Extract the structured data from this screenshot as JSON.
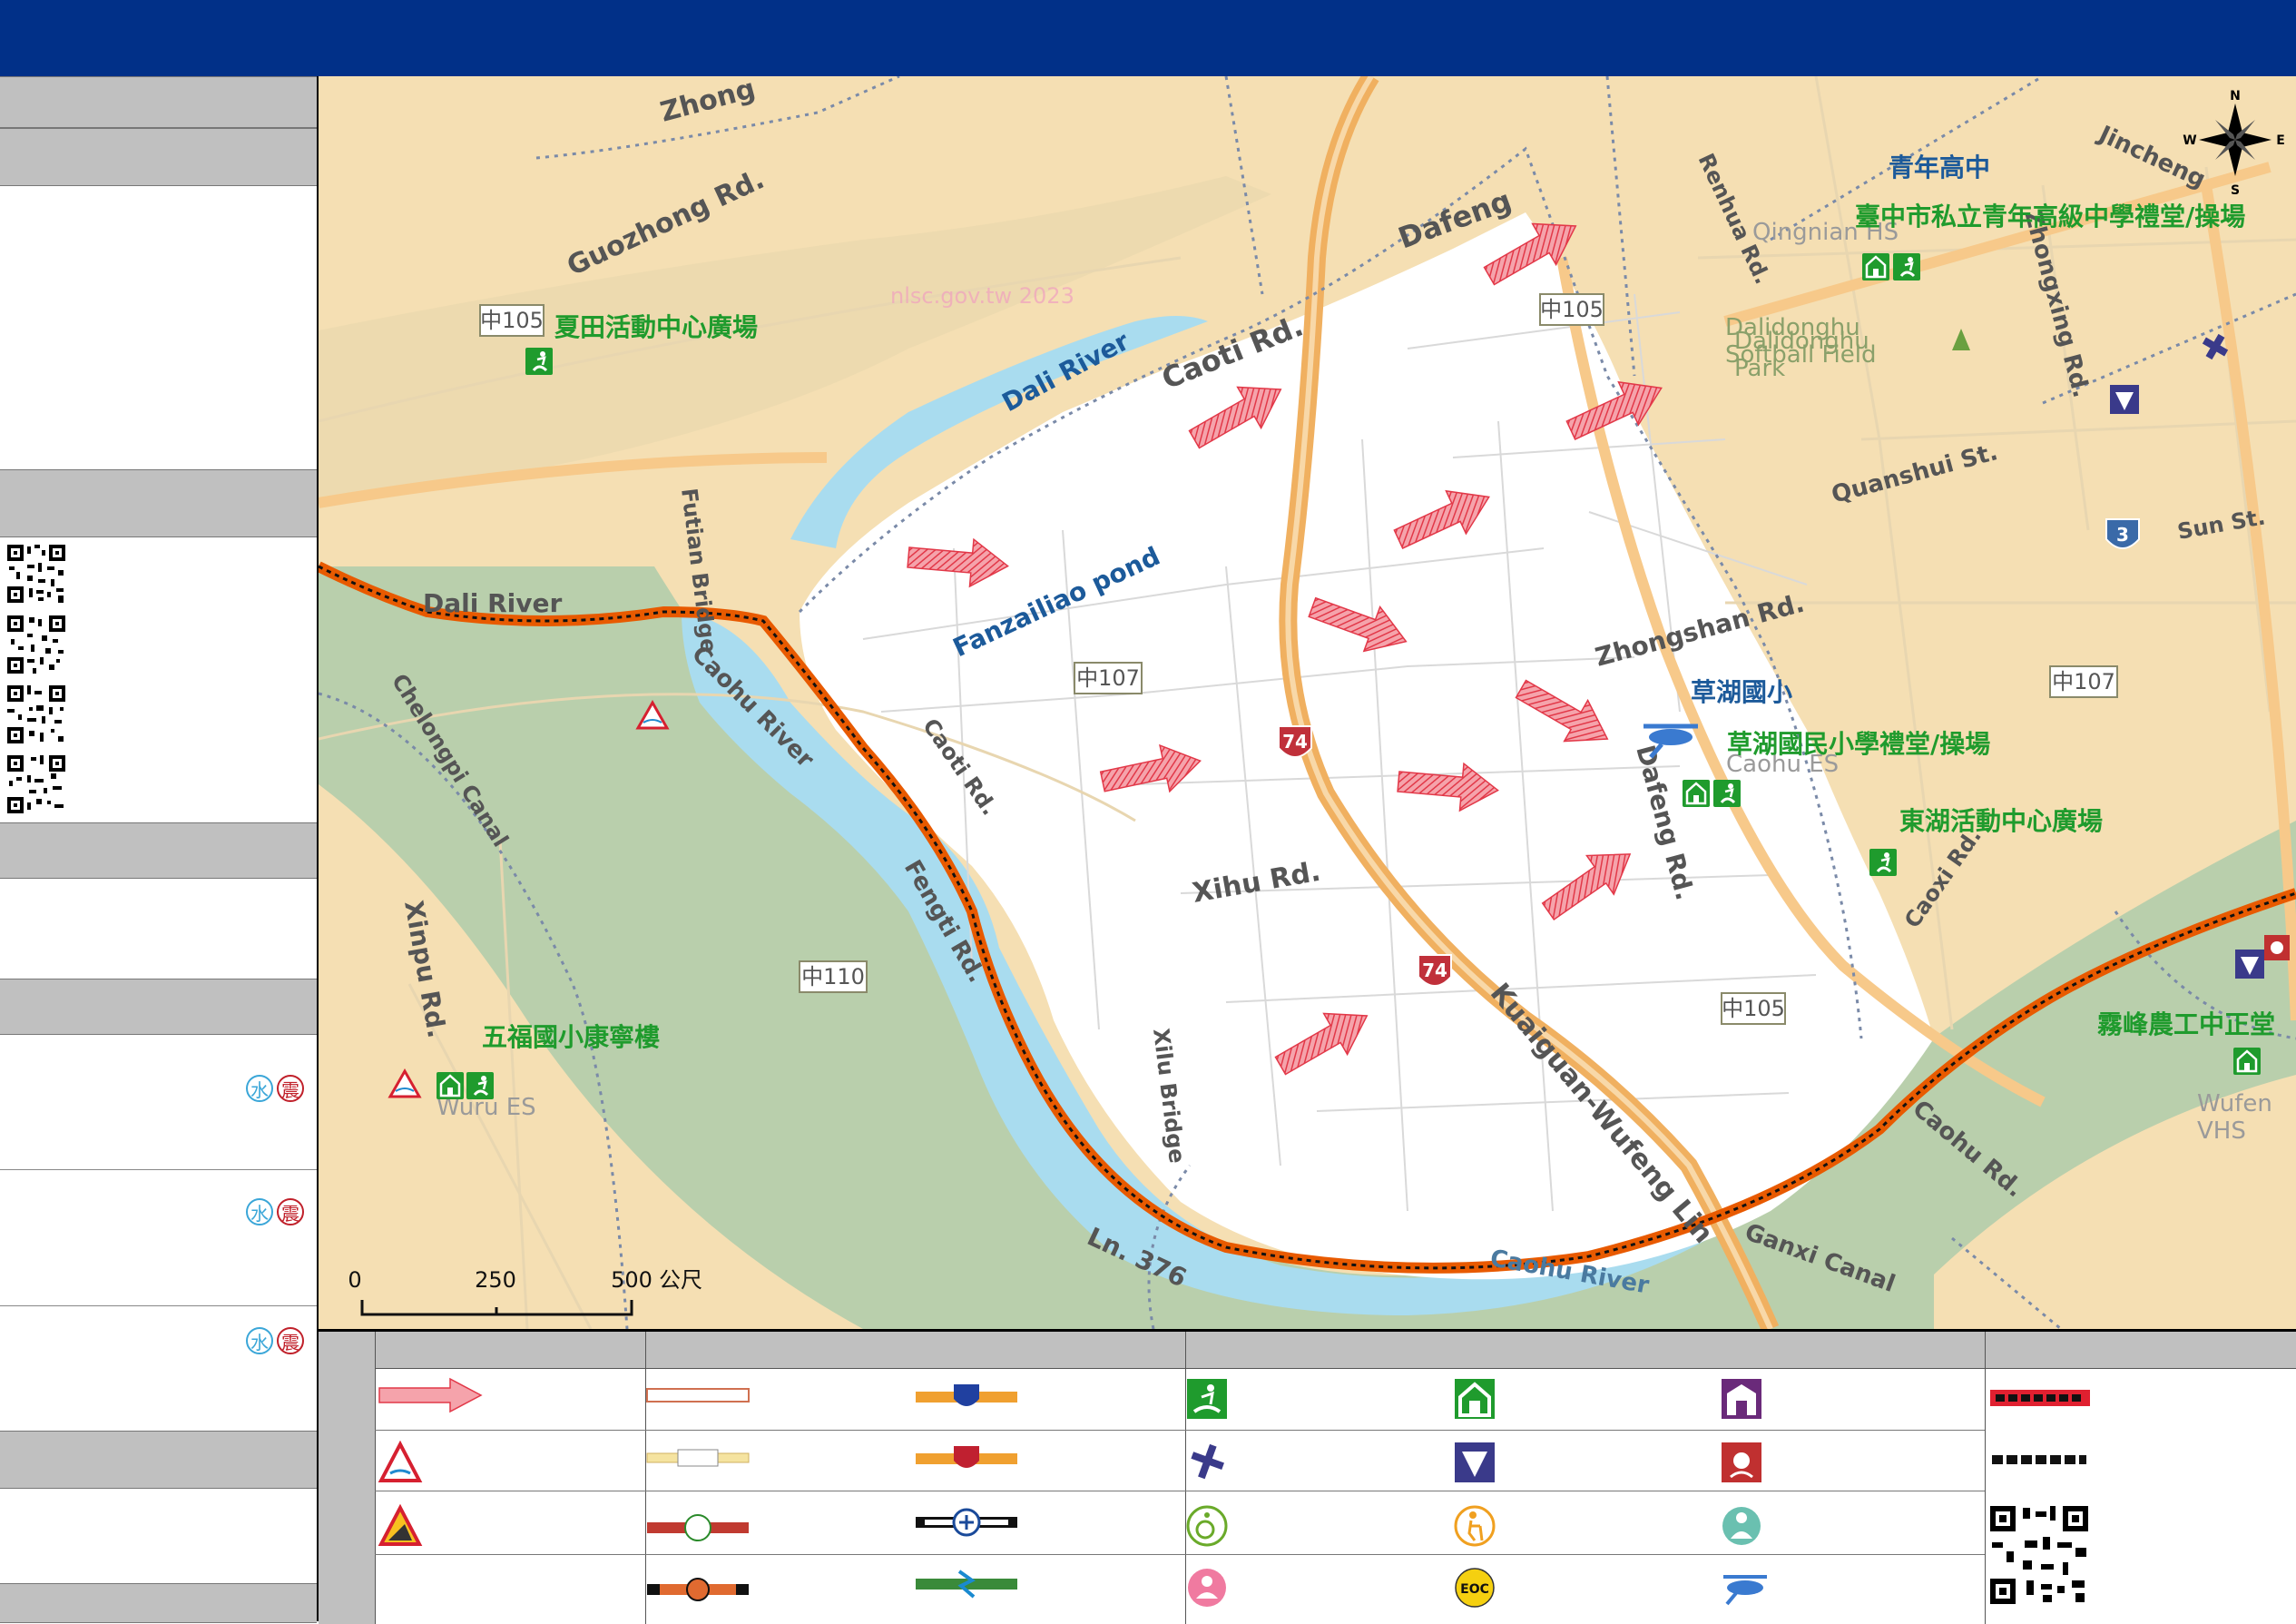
{
  "header": {
    "title": ""
  },
  "map": {
    "labels": {
      "zhong": "Zhong",
      "guozhong_rd": "Guozhong Rd.",
      "dafeng_top": "Dafeng",
      "caoti_rd_top": "Caoti Rd.",
      "dali_river_top": "Dali River",
      "dali_river_left": "Dali River",
      "fanzailiao_pond": "Fanzailiao pond",
      "caohu_river_left": "Caohu River",
      "caoti_rd_mid": "Caoti Rd.",
      "futian_bridge": "Futian Bridge",
      "guangxing_canal": "Chelongpi Canal",
      "xinpu_rd": "Xinpu Rd.",
      "fengti_rd": "Fengti Rd.",
      "xilu_bridge": "Xilu Bridge",
      "ln376": "Ln. 376",
      "xihu_rd": "Xihu Rd.",
      "zhongshan_rd": "Zhongshan Rd.",
      "dafeng_rd": "Dafeng Rd.",
      "kuaiguan_wufeng": "Kuaiguan-Wufeng Lin",
      "caohu_river_bottom": "Caohu River",
      "ganxi_canal": "Ganxi Canal",
      "caohu_rd": "Caohu Rd.",
      "caoxi_rd": "Caoxi Rd.",
      "renhua_rd": "Renhua Rd.",
      "jincheng": "Jincheng",
      "quanshui_st": "Quanshui St.",
      "zhongxing_rd": "Zhongxing Rd.",
      "qingnian_hs": "Qingnian HS",
      "dalidonghu_softball": "Dalidonghu\nSoftball Field",
      "dalidonghu_park": "Dalidonghu\nPark",
      "caohu_es": "Caohu ES",
      "wuru_es": "Wuru ES",
      "wufeng_vhs": "Wufen\nVHS",
      "sun_st": "Sun St.",
      "watermark": "nlsc.gov.tw 2023"
    },
    "roads": {
      "z105_a": "中105",
      "z105_b": "中105",
      "z105_c": "中105",
      "z107_a": "中107",
      "z107_b": "中107",
      "z110": "中110",
      "r74_a": "74",
      "r74_b": "74",
      "r3": "3"
    },
    "places": {
      "qingnian_name": "青年高中",
      "qingnian_shelter": "臺中市私立青年高級中學禮堂/操場",
      "xiatian": "夏田活動中心廣場",
      "caohu_school": "草湖國小",
      "caohu_shelter": "草湖國民小學禮堂/操場",
      "donghu": "東湖活動中心廣場",
      "wufu": "五福國小康寧樓",
      "wufeng_ag": "霧峰農工中正堂"
    },
    "scale": {
      "t0": "0",
      "t1": "250",
      "t2": "500",
      "unit": "公尺"
    },
    "compass": {
      "n": "N",
      "s": "S",
      "e": "E",
      "w": "W"
    }
  },
  "sidebar": {
    "hazards": [
      {
        "water": "水",
        "quake": "震"
      },
      {
        "water": "水",
        "quake": "震"
      },
      {
        "water": "水",
        "quake": "震"
      }
    ]
  },
  "colors": {
    "header": "#013088",
    "map_base": "#f5dfb3",
    "river": "#a9dcef",
    "riverbank": "#b9cfac",
    "flood_zone": "#ffffff",
    "arrow": "#e8495a",
    "boundary": "#e85a00",
    "shelter_green": "#1f9b2d",
    "label_blue": "#1c5a9a"
  },
  "legend": {
    "icons": [
      "evacuation-arrow-icon",
      "road-outline-icon",
      "highway-shield-blue-icon",
      "outdoor-shelter-icon",
      "indoor-shelter-icon",
      "police-station-icon",
      "boundary-line-icon",
      "flood-hazard-icon",
      "provincial-road-icon",
      "highway-shield-red-icon",
      "medical-icon",
      "police-badge-icon",
      "fire-department-icon",
      "district-line-icon",
      "landslide-hazard-icon",
      "county-road-icon",
      "railway-station-icon",
      "wheelchair-icon",
      "elderly-care-icon",
      "nursery-icon",
      "qr-code-icon",
      "local-road-icon",
      "hsr-icon",
      "child-welfare-icon",
      "eoc-icon",
      "helipad-icon"
    ],
    "eoc": "EOC"
  }
}
